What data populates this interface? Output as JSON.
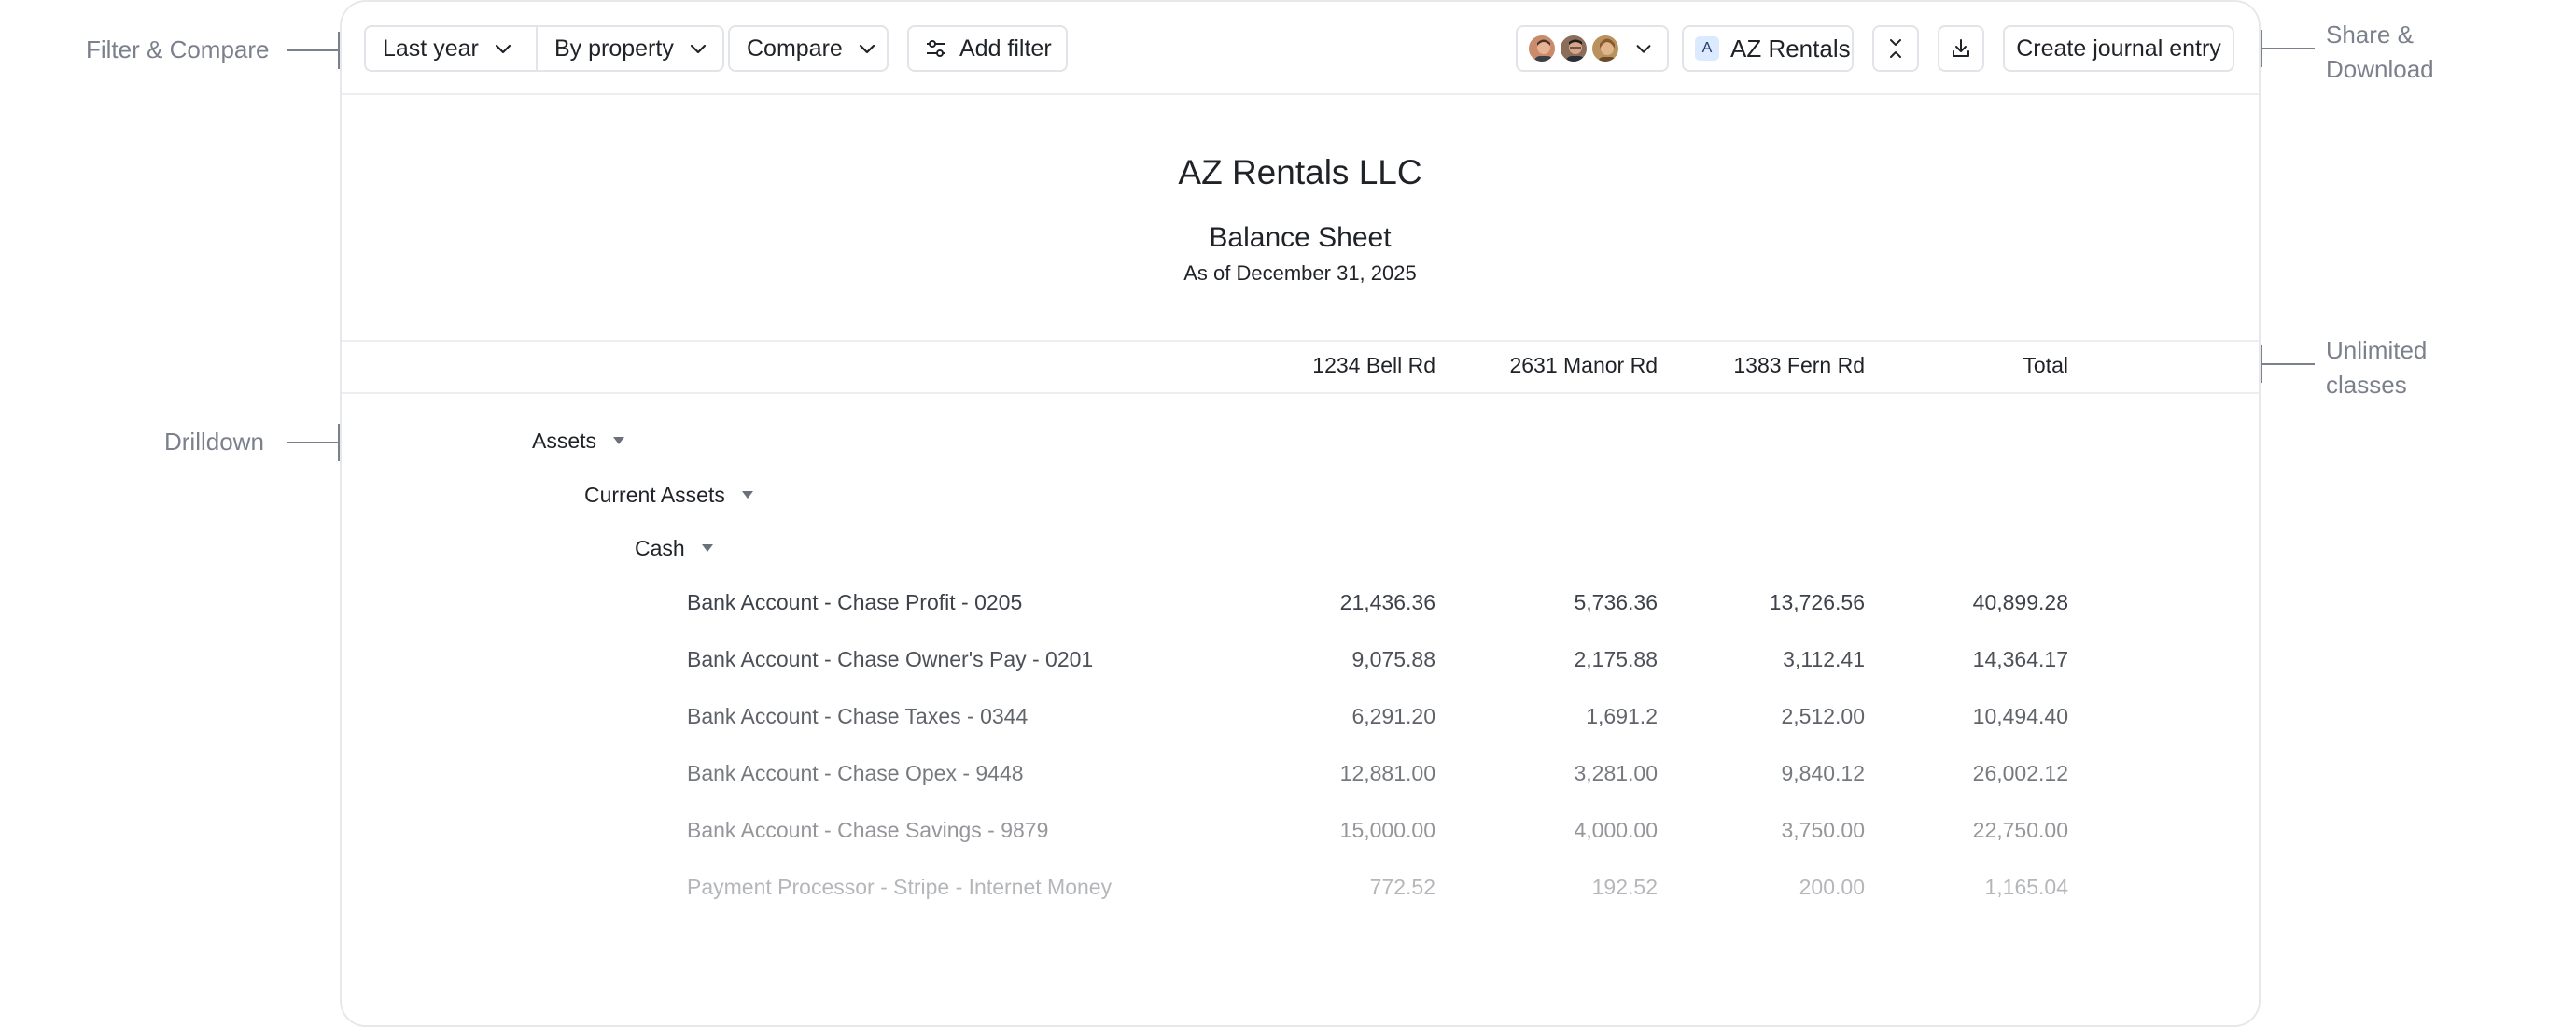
{
  "annotations": {
    "filter_compare": "Filter & Compare",
    "drilldown": "Drilldown",
    "share_download_1": "Share &",
    "share_download_2": "Download",
    "unlimited_classes_1": "Unlimited",
    "unlimited_classes_2": "classes"
  },
  "toolbar": {
    "period": "Last year",
    "group_by": "By property",
    "compare": "Compare",
    "add_filter": "Add filter",
    "entity_badge": "A",
    "entity": "AZ Rentals",
    "create_journal": "Create journal entry",
    "icons": [
      "filter-sliders-icon",
      "collapse-icon",
      "download-icon",
      "chevron-down-icon"
    ]
  },
  "report": {
    "company": "AZ Rentals LLC",
    "title": "Balance Sheet",
    "as_of": "As of December 31, 2025",
    "columns": [
      "1234 Bell Rd",
      "2631 Manor Rd",
      "1383 Fern Rd",
      "Total"
    ]
  },
  "sections": {
    "assets": "Assets",
    "current_assets": "Current Assets",
    "cash": "Cash"
  },
  "accounts": [
    {
      "name": "Bank Account - Chase Profit - 0205",
      "values": [
        "21,436.36",
        "5,736.36",
        "13,726.56",
        "40,899.28"
      ]
    },
    {
      "name": "Bank Account - Chase Owner's Pay - 0201",
      "values": [
        "9,075.88",
        "2,175.88",
        "3,112.41",
        "14,364.17"
      ]
    },
    {
      "name": "Bank Account - Chase Taxes - 0344",
      "values": [
        "6,291.20",
        "1,691.2",
        "2,512.00",
        "10,494.40"
      ]
    },
    {
      "name": "Bank Account - Chase Opex - 9448",
      "values": [
        "12,881.00",
        "3,281.00",
        "9,840.12",
        "26,002.12"
      ]
    },
    {
      "name": "Bank Account - Chase Savings - 9879",
      "values": [
        "15,000.00",
        "4,000.00",
        "3,750.00",
        "22,750.00"
      ]
    },
    {
      "name": "Payment Processor - Stripe - Internet Money",
      "values": [
        "772.52",
        "192.52",
        "200.00",
        "1,165.04"
      ]
    }
  ],
  "colors": {
    "accent_badge": "#dbeafe",
    "annotation": "#7b818c",
    "border": "#e1e4e8"
  }
}
